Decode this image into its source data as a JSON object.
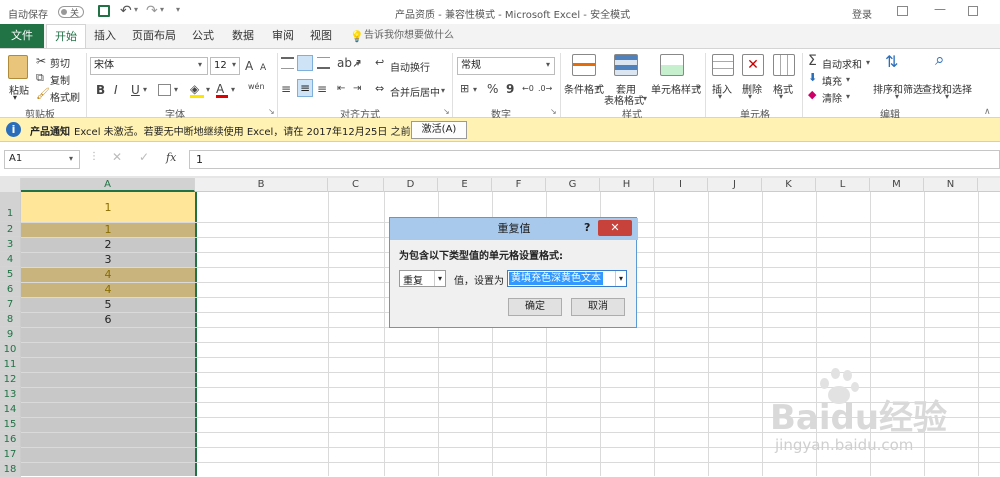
{
  "titlebar": {
    "autosave_label": "自动保存",
    "autosave_state": "关",
    "title": "产品资质  -  兼容性模式  -  Microsoft Excel  -  安全模式",
    "login": "登录"
  },
  "tabs": [
    "文件",
    "开始",
    "插入",
    "页面布局",
    "公式",
    "数据",
    "审阅",
    "视图"
  ],
  "active_tab": "开始",
  "tell_me": "告诉我你想要做什么",
  "ribbon": {
    "clipboard": {
      "paste": "粘贴",
      "cut": "剪切",
      "copy": "复制",
      "format_painter": "格式刷",
      "label": "剪贴板"
    },
    "font": {
      "name": "宋体",
      "size": "12",
      "bold": "B",
      "italic": "I",
      "underline": "U",
      "label": "字体",
      "size_up": "A",
      "size_down": "A",
      "font_color_glyph": "A",
      "phonetic": "wén"
    },
    "alignment": {
      "wrap": "自动换行",
      "merge": "合并后居中",
      "label": "对齐方式"
    },
    "number": {
      "format": "常规",
      "percent": "%",
      "comma": "9",
      "label": "数字"
    },
    "styles": {
      "conditional": "条件格式",
      "table_line1": "套用",
      "table_line2": "表格格式",
      "cell_styles": "单元格样式",
      "label": "样式"
    },
    "cells": {
      "insert": "插入",
      "delete": "删除",
      "format": "格式",
      "label": "单元格"
    },
    "editing": {
      "autosum": "自动求和",
      "fill": "填充",
      "clear": "清除",
      "sort": "排序和筛选",
      "find": "查找和选择",
      "label": "编辑"
    }
  },
  "notification": {
    "title": "产品通知",
    "message": "Excel 未激活。若要无中断地继续使用 Excel，请在 2017年12月25日 之前激活。",
    "button": "激活(A)"
  },
  "formula_bar": {
    "name_box": "A1",
    "fx": "fx",
    "value": "1"
  },
  "columns": [
    "A",
    "B",
    "C",
    "D",
    "E",
    "F",
    "G",
    "H",
    "I",
    "J",
    "K",
    "L",
    "M",
    "N"
  ],
  "rows": [
    "1",
    "2",
    "3",
    "4",
    "5",
    "6",
    "7",
    "8",
    "9",
    "10",
    "11",
    "12",
    "13",
    "14",
    "15",
    "16",
    "17",
    "18"
  ],
  "cells_A": [
    "1",
    "1",
    "2",
    "3",
    "4",
    "4",
    "5",
    "6"
  ],
  "dialog": {
    "title": "重复值",
    "help": "?",
    "close": "✕",
    "prompt": "为包含以下类型值的单元格设置格式:",
    "type_value": "重复",
    "middle_label": "值，设置为",
    "format_value": "黄填充色深黄色文本",
    "ok": "确定",
    "cancel": "取消"
  },
  "watermark": {
    "brand": "Baidu经验",
    "url": "jingyan.baidu.com"
  },
  "colors": {
    "excel_green": "#217346",
    "selection_gray": "#c8c8c8",
    "highlight_dark_yellow": "#c8b47c",
    "highlight_light_yellow": "#ffe699",
    "notification_bg": "#fff2b3",
    "dialog_title_bg": "#a8c9ec",
    "close_red": "#c7423a"
  }
}
